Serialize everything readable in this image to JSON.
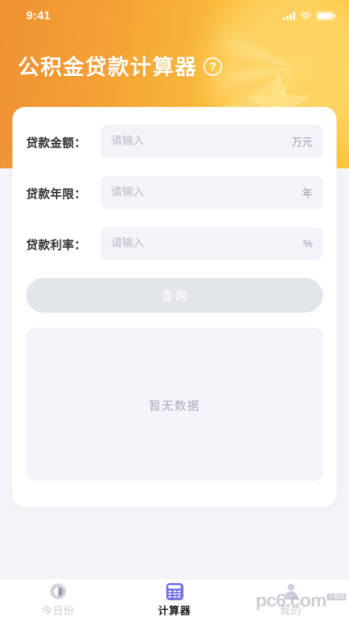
{
  "theme": {
    "header_gradient_start": "#EF9133",
    "header_gradient_end": "#FDC83F",
    "accent_blue": "#6F79E8",
    "page_background": "#F4F5F9",
    "card_background": "#FFFFFF",
    "input_background": "#F3F4F8",
    "disabled_button": "#E2E5EA",
    "muted_text": "#A9AAB8"
  },
  "status_bar": {
    "time": "9:41",
    "signal_icon": "signal-bars-icon",
    "wifi_icon": "wifi-icon",
    "battery_icon": "battery-full-icon"
  },
  "header": {
    "title": "公积金贷款计算器",
    "help_icon": "question-mark-circle-icon",
    "help_label": "?"
  },
  "form": {
    "fields": [
      {
        "label": "贷款金额：",
        "placeholder": "请输入",
        "value": "",
        "unit": "万元"
      },
      {
        "label": "贷款年限：",
        "placeholder": "请输入",
        "value": "",
        "unit": "年"
      },
      {
        "label": "贷款利率：",
        "placeholder": "请输入",
        "value": "",
        "unit": "%"
      }
    ],
    "submit_label": "查询",
    "submit_disabled": true
  },
  "result": {
    "empty_text": "暂无数据"
  },
  "tabbar": {
    "items": [
      {
        "label": "今日份",
        "icon": "brightness-sun-icon",
        "active": false
      },
      {
        "label": "计算器",
        "icon": "calculator-icon",
        "active": true
      },
      {
        "label": "我的",
        "icon": "user-person-icon",
        "active": false
      }
    ]
  },
  "watermark": {
    "text": "pc6.com",
    "badge": "下载站"
  }
}
